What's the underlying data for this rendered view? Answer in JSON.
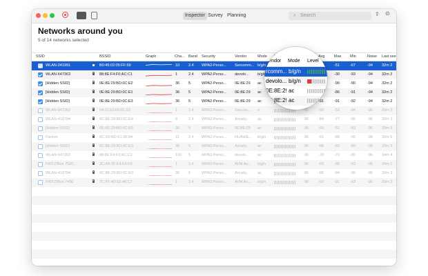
{
  "toolbar": {
    "tabs": [
      "Inspector",
      "Survey",
      "Planning"
    ],
    "active_tab": "Inspector",
    "search_placeholder": "Search"
  },
  "page": {
    "title": "Networks around you",
    "subtitle": "5 of 14 networks selected"
  },
  "columns": [
    "SSID",
    "BSSID",
    "Graph",
    "Cha...",
    "Band",
    "Security",
    "Vendor",
    "Mode",
    "Level",
    "Signal",
    "Avg",
    "Max",
    "Min",
    "Noise",
    "Last seen"
  ],
  "rows": [
    {
      "ssid": "WLAN-241991",
      "bssid": "B0:45:02:05:FF:59",
      "channel": "10",
      "band": "2.4",
      "security": "WPA2-Perso...",
      "vendor": "Sercomm...",
      "mode": "b/g/n",
      "signal": "-52",
      "avg": "-59",
      "max": "-51",
      "min": "-67",
      "noise": "-94",
      "last": "32m 2",
      "checked": true,
      "selected": true
    },
    {
      "ssid": "WLAN-647363",
      "bssid": "88:8E:F4:F0:AC:C1",
      "channel": "1",
      "band": "2.4",
      "security": "WPA2-Perso...",
      "vendor": "devolo...",
      "mode": "b/g/n",
      "signal": "-77",
      "avg": "-69",
      "max": "-30",
      "min": "-93",
      "noise": "-94",
      "last": "32m 2",
      "checked": true
    },
    {
      "ssid": "[Hidden SSID]",
      "bssid": "0E:8E:29:BD:0C:E2",
      "channel": "36",
      "band": "5",
      "security": "WPA2-Perso...",
      "vendor": "0E:8E:29",
      "mode": "ac",
      "signal": "-90",
      "avg": "-90",
      "max": "-90",
      "min": "-90",
      "noise": "-94",
      "last": "32m 2",
      "checked": true
    },
    {
      "ssid": "[Hidden SSID]",
      "bssid": "0E:8E:29:BD:0C:E1",
      "channel": "36",
      "band": "5",
      "security": "WPA2-Perso...",
      "vendor": "0E:8E:29",
      "mode": "ac",
      "signal": "-91",
      "avg": "-88",
      "max": "-86",
      "min": "-91",
      "noise": "-94",
      "last": "32m 2",
      "checked": true
    },
    {
      "ssid": "[Hidden SSID]",
      "bssid": "0E:8E:29:BD:0C:E3",
      "channel": "36",
      "band": "5",
      "security": "WPA2-Perso...",
      "vendor": "0E:8E:29",
      "mode": "ac",
      "signal": "-91",
      "avg": "-91",
      "max": "-91",
      "min": "-92",
      "noise": "-94",
      "last": "32m 2",
      "checked": true
    },
    {
      "ssid": "WLAN-647363",
      "bssid": "04:21:22:66:6C:53",
      "channel": "1",
      "band": "2.4",
      "security": "WPA2-Perso...",
      "vendor": "Sercom...",
      "mode": "n",
      "signal": "-96",
      "avg": "-58",
      "max": "-53",
      "min": "-94",
      "noise": "-96",
      "last": "33m 3"
    },
    {
      "ssid": "WLAN-419794",
      "bssid": "0C:8E:29:BD:0C:E4",
      "channel": "6",
      "band": "2.4",
      "security": "WPA2-Perso...",
      "vendor": "Arcady...",
      "mode": "ac",
      "signal": "-96",
      "avg": "-84",
      "max": "-77",
      "min": "-96",
      "noise": "-96",
      "last": "33m 3"
    },
    {
      "ssid": "[Hidden SSID]",
      "bssid": "0E:8E:29:BD:0C:E0",
      "channel": "36",
      "band": "5",
      "security": "WPA2-Perso...",
      "vendor": "0E:8E:29",
      "mode": "ac",
      "signal": "-96",
      "avg": "-90",
      "max": "-81",
      "min": "-93",
      "noise": "-96",
      "last": "33m 3"
    },
    {
      "ssid": "Fischer",
      "bssid": "0C:D6:BD:61:38:5A",
      "channel": "11",
      "band": "2.4",
      "security": "WPA2-Perso...",
      "vendor": "HUAWE...",
      "mode": "b/g/n",
      "signal": "-96",
      "avg": "-91",
      "max": "-88",
      "min": "-95",
      "noise": "-96",
      "last": "33m 5"
    },
    {
      "ssid": "[Hidden SSID]",
      "bssid": "0C:8E:29:BD:0C:E3",
      "channel": "36",
      "band": "5",
      "security": "WPA2-Perso...",
      "vendor": "Arcady...",
      "mode": "ac",
      "signal": "-96",
      "avg": "-88",
      "max": "-83",
      "min": "-89",
      "noise": "-96",
      "last": "33m 3"
    },
    {
      "ssid": "WLAN-647363",
      "bssid": "88:8E:F4:F0:AC:C2",
      "channel": "100",
      "band": "5",
      "security": "WPA2-Perso...",
      "vendor": "devolo...",
      "mode": "ac",
      "signal": "-96",
      "avg": "-78",
      "max": "-76",
      "min": "-80",
      "noise": "-96",
      "last": "34m 4"
    },
    {
      "ssid": "FRITZ!Box 7520...",
      "bssid": "3C:A6:2F:E4:E6:F9",
      "channel": "1",
      "band": "2.4",
      "security": "WPA2-Perso...",
      "vendor": "AVM Au...",
      "mode": "b/g/n",
      "signal": "-96",
      "avg": "-89",
      "max": "-86",
      "min": "-93",
      "noise": "-96",
      "last": "34m 1"
    },
    {
      "ssid": "WLAN-419794",
      "bssid": "0C:8E:29:BD:0C:E0",
      "channel": "36",
      "band": "5",
      "security": "WPA2-Perso...",
      "vendor": "Arcady...",
      "mode": "ac",
      "signal": "-96",
      "avg": "-88",
      "max": "-84",
      "min": "-90",
      "noise": "-96",
      "last": "33m 3"
    },
    {
      "ssid": "FRITZ!Box 7490",
      "bssid": "7C:FF:4D:52:46:C7",
      "channel": "1",
      "band": "2.4",
      "security": "WPA2-Perso...",
      "vendor": "AVM Au...",
      "mode": "b/g/n",
      "signal": "-96",
      "avg": "-92",
      "max": "-91",
      "min": "-93",
      "noise": "-96",
      "last": "33m 3"
    }
  ],
  "magnifier": {
    "columns": [
      "Vendor",
      "Mode",
      "Level"
    ],
    "rows": [
      {
        "vendor": "rcomm...",
        "mode": "b/g/n"
      },
      {
        "vendor": "devolo...",
        "mode": "b/g/n"
      },
      {
        "vendor": "0E:8E:29",
        "mode": "ac"
      },
      {
        "vendor": "0E:8E:29",
        "mode": "ac"
      }
    ]
  },
  "colors": {
    "selection": "#1a5fd1",
    "checkbox": "#3d8fe6",
    "level_green": "#4cae4c",
    "level_red": "#e23b3b",
    "graph_line": "#e23b3b"
  }
}
